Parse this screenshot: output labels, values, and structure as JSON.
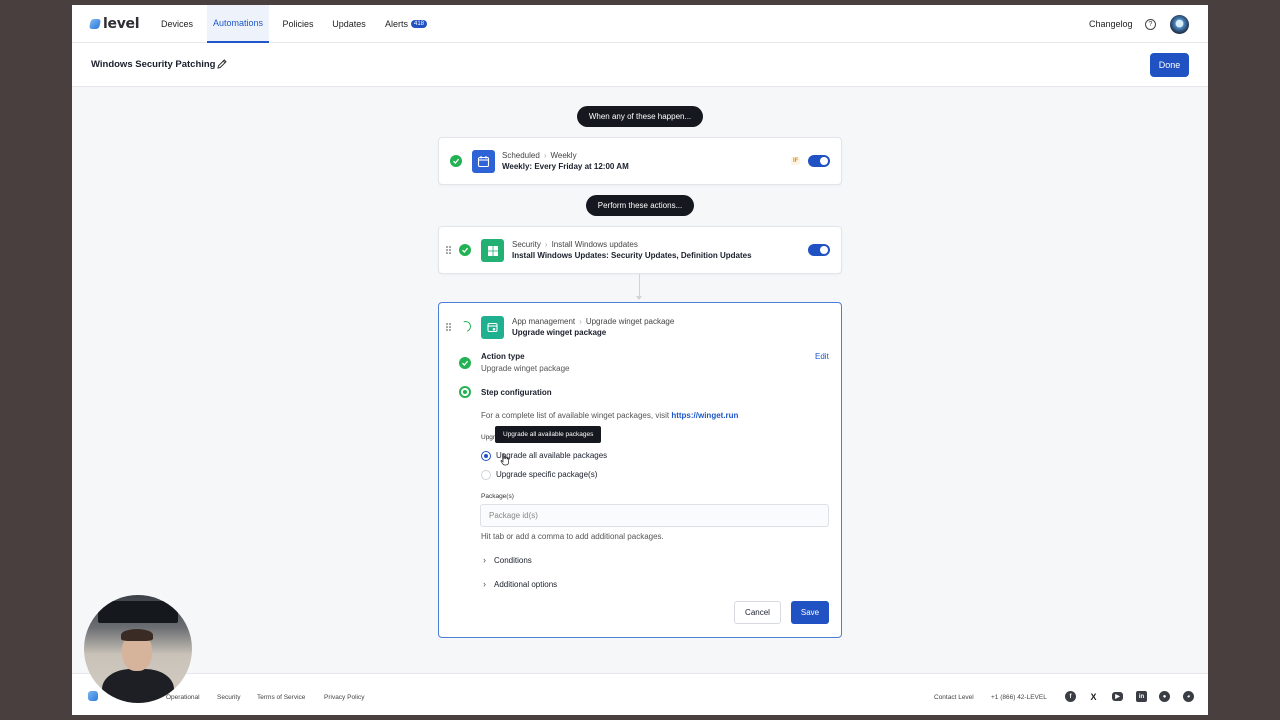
{
  "nav": {
    "logo": "level",
    "items": [
      {
        "label": "Devices"
      },
      {
        "label": "Automations"
      },
      {
        "label": "Policies"
      },
      {
        "label": "Updates"
      },
      {
        "label": "Alerts",
        "badge": "418"
      }
    ],
    "changelog": "Changelog"
  },
  "header": {
    "title": "Windows Security Patching",
    "done_label": "Done"
  },
  "trigger_pill": "When any of these happen...",
  "actions_pill": "Perform these actions...",
  "trigger_card": {
    "category": "Scheduled",
    "subcategory": "Weekly",
    "title": "Weekly: Every Friday at 12:00 AM",
    "if_badge": "IF",
    "enabled": true
  },
  "action_card": {
    "category": "Security",
    "subcategory": "Install Windows updates",
    "title": "Install Windows Updates: Security Updates, Definition Updates",
    "enabled": true
  },
  "edit_card": {
    "category": "App management",
    "subcategory": "Upgrade winget package",
    "title": "Upgrade winget package",
    "action_type_label": "Action type",
    "action_type_value": "Upgrade winget package",
    "edit_label": "Edit",
    "step_config_label": "Step configuration",
    "help_text": "For a complete list of available winget packages, visit",
    "help_link": "https://winget.run",
    "upgrade_label_partial": "Upgr",
    "tooltip": "Upgrade all available packages",
    "options": [
      {
        "label": "Upgrade all available packages",
        "selected": true
      },
      {
        "label": "Upgrade specific package(s)",
        "selected": false
      }
    ],
    "packages_label": "Package(s)",
    "packages_placeholder": "Package id(s)",
    "packages_hint": "Hit tab or add a comma to add additional packages.",
    "conditions_label": "Conditions",
    "additional_label": "Additional options",
    "cancel_label": "Cancel",
    "save_label": "Save"
  },
  "footer": {
    "status": "Operational",
    "links": [
      "Security",
      "Terms of Service",
      "Privacy Policy"
    ],
    "contact": "Contact Level",
    "phone": "+1 (866) 42-LEVEL",
    "socials": [
      "facebook-icon",
      "x-icon",
      "youtube-icon",
      "linkedin-icon",
      "github-icon",
      "reddit-icon"
    ]
  },
  "colors": {
    "accent": "#2152c4",
    "success": "#22b153",
    "pill_bg": "#15181f",
    "if_badge": "#d98c1f"
  }
}
